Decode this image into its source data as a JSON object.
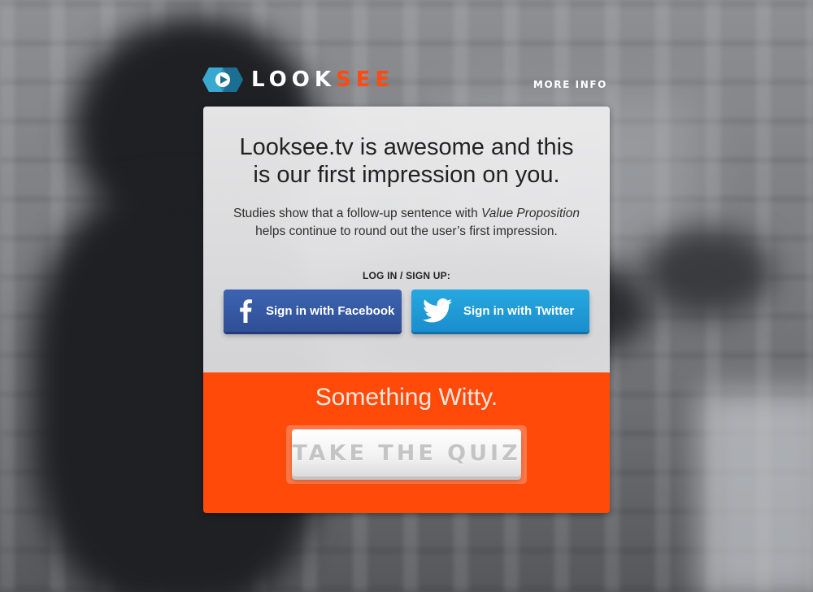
{
  "header": {
    "logo_text_main": "LOOK",
    "logo_text_accent": "SEE",
    "more_info_label": "MORE INFO"
  },
  "hero": {
    "headline": "Looksee.tv is awesome and this is our first impression on you.",
    "sub_before": "Studies show that a follow-up sentence with ",
    "sub_emphasis": "Value Proposition",
    "sub_after": " helps continue to round out the user’s first impression."
  },
  "auth": {
    "label": "LOG IN / SIGN UP:",
    "facebook_label": "Sign in with Facebook",
    "twitter_label": "Sign in with Twitter",
    "facebook_icon": "facebook-icon",
    "twitter_icon": "twitter-bird-icon"
  },
  "cta": {
    "tagline": "Something Witty.",
    "quiz_label": "TAKE THE QUIZ"
  },
  "colors": {
    "accent": "#ff4a0a",
    "facebook": "#3458a4",
    "twitter": "#1f9bd8",
    "logo_blue": "#2a8fb3"
  }
}
